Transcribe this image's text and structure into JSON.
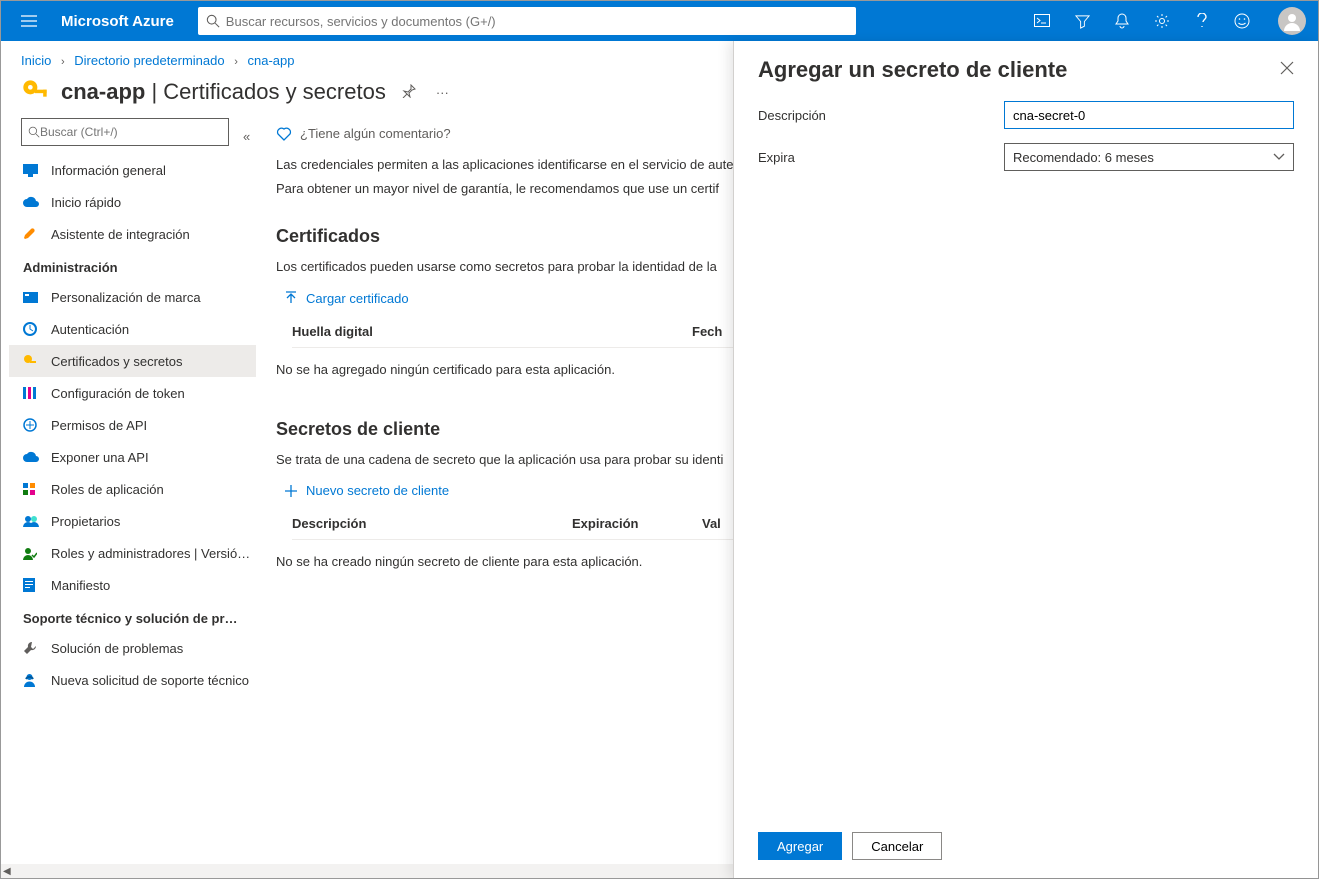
{
  "topbar": {
    "brand": "Microsoft Azure",
    "search_placeholder": "Buscar recursos, servicios y documentos (G+/)"
  },
  "breadcrumbs": {
    "item1": "Inicio",
    "item2": "Directorio predeterminado",
    "item3": "cna-app"
  },
  "page": {
    "title_app": "cna-app",
    "title_rest": " | Certificados y secretos"
  },
  "sidenav": {
    "search_placeholder": "Buscar (Ctrl+/)",
    "items": [
      {
        "label": "Información general"
      },
      {
        "label": "Inicio rápido"
      },
      {
        "label": "Asistente de integración"
      }
    ],
    "group_admin": "Administración",
    "admin_items": [
      {
        "label": "Personalización de marca"
      },
      {
        "label": "Autenticación"
      },
      {
        "label": "Certificados y secretos"
      },
      {
        "label": "Configuración de token"
      },
      {
        "label": "Permisos de API"
      },
      {
        "label": "Exponer una API"
      },
      {
        "label": "Roles de aplicación"
      },
      {
        "label": "Propietarios"
      },
      {
        "label": "Roles y administradores | Versió…"
      },
      {
        "label": "Manifiesto"
      }
    ],
    "group_support": "Soporte técnico y solución de probl…",
    "support_items": [
      {
        "label": "Solución de problemas"
      },
      {
        "label": "Nueva solicitud de soporte técnico"
      }
    ]
  },
  "main": {
    "feedback": "¿Tiene algún comentario?",
    "cred_desc1": "Las credenciales permiten a las aplicaciones identificarse en el servicio de aute",
    "cred_desc2": "Para obtener un mayor nivel de garantía, le recomendamos que use un certif",
    "certs_h": "Certificados",
    "certs_desc": "Los certificados pueden usarse como secretos para probar la identidad de la",
    "upload_cert": "Cargar certificado",
    "cert_col1": "Huella digital",
    "cert_col2": "Fech",
    "cert_empty": "No se ha agregado ningún certificado para esta aplicación.",
    "secrets_h": "Secretos de cliente",
    "secrets_desc": "Se trata de una cadena de secreto que la aplicación usa para probar su identi",
    "new_secret": "Nuevo secreto de cliente",
    "secret_col1": "Descripción",
    "secret_col2": "Expiración",
    "secret_col3": "Val",
    "secret_empty": "No se ha creado ningún secreto de cliente para esta aplicación."
  },
  "flyout": {
    "title": "Agregar un secreto de cliente",
    "desc_label": "Descripción",
    "desc_value": "cna-secret-0",
    "expires_label": "Expira",
    "expires_value": "Recomendado: 6 meses",
    "add_btn": "Agregar",
    "cancel_btn": "Cancelar"
  }
}
